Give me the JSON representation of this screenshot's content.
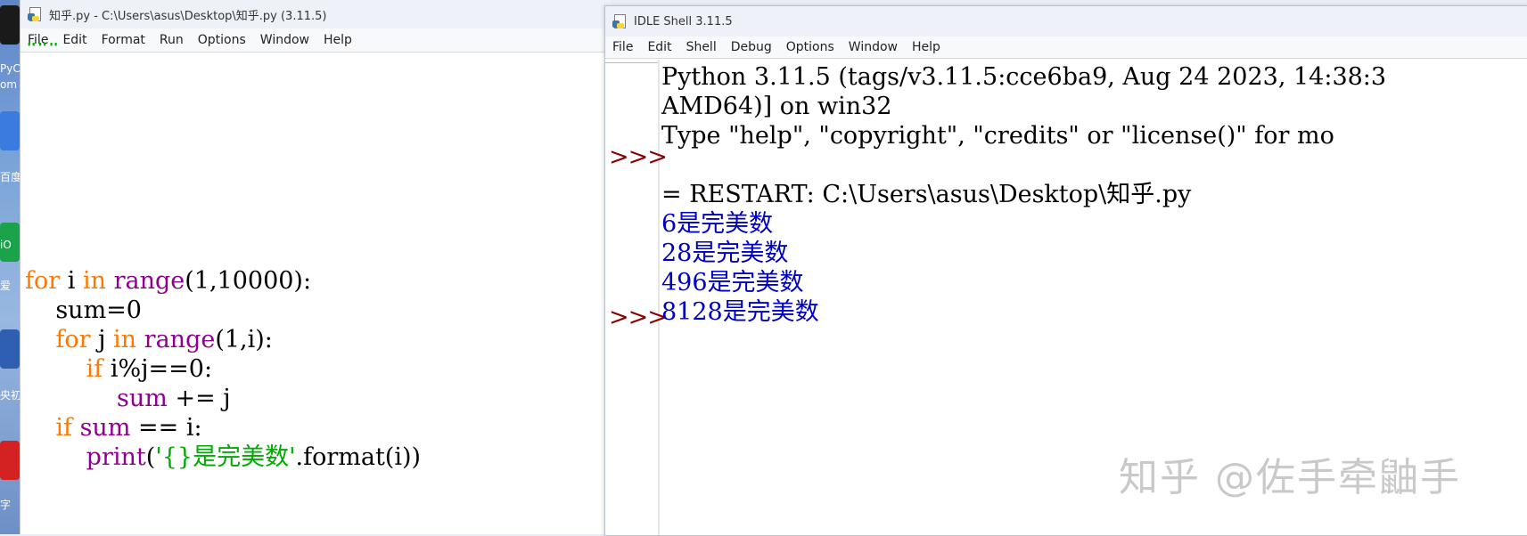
{
  "desktop": {
    "labels": [
      "PyC",
      "om",
      "百度",
      "iO",
      "爱",
      "央初",
      "字"
    ]
  },
  "editor": {
    "title": "知乎.py - C:\\Users\\asus\\Desktop\\知乎.py (3.11.5)",
    "menu": [
      "File",
      "Edit",
      "Format",
      "Run",
      "Options",
      "Window",
      "Help"
    ],
    "top_fragment": "\"\"\"",
    "code": {
      "l1_kw": "for",
      "l1_a": " i ",
      "l1_kw2": "in",
      "l1_sp": " ",
      "l1_bi": "range",
      "l1_b": "(1,10000):",
      "l2": "    sum=0",
      "l3_ind": "    ",
      "l3_kw": "for",
      "l3_a": " j ",
      "l3_kw2": "in",
      "l3_sp": " ",
      "l3_bi": "range",
      "l3_b": "(1,i):",
      "l4_ind": "        ",
      "l4_kw": "if",
      "l4_a": " i%j==0:",
      "l5_ind": "            ",
      "l5_bi": "sum",
      "l5_a": " += j",
      "l6_ind": "    ",
      "l6_kw": "if",
      "l6_sp": " ",
      "l6_bi": "sum",
      "l6_a": " == i:",
      "l7_ind": "        ",
      "l7_bi": "print",
      "l7_a": "(",
      "l7_str": "'{}是完美数'",
      "l7_b": ".format(i))"
    }
  },
  "shell": {
    "title": "IDLE Shell 3.11.5",
    "menu": [
      "File",
      "Edit",
      "Shell",
      "Debug",
      "Options",
      "Window",
      "Help"
    ],
    "prompt": ">>>",
    "banner1": "Python 3.11.5 (tags/v3.11.5:cce6ba9, Aug 24 2023, 14:38:3",
    "banner2": "AMD64)] on win32",
    "banner3": "Type \"help\", \"copyright\", \"credits\" or \"license()\" for mo",
    "restart": "= RESTART: C:\\Users\\asus\\Desktop\\知乎.py",
    "outputs": [
      "6是完美数",
      "28是完美数",
      "496是完美数",
      "8128是完美数"
    ]
  },
  "watermark": "知乎 @佐手牵鼬手"
}
